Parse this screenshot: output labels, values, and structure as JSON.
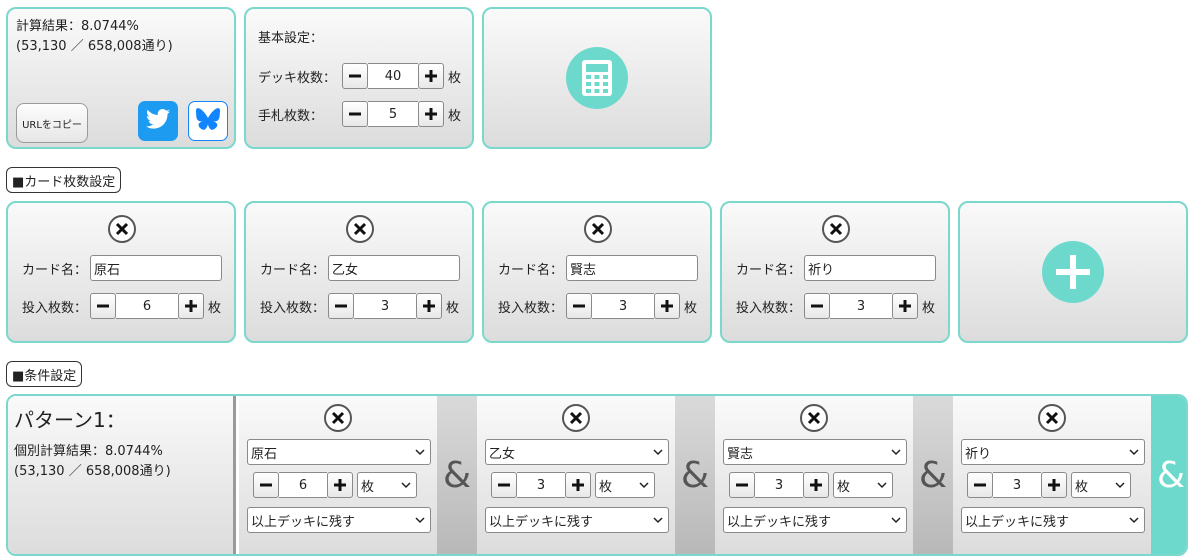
{
  "result": {
    "line1": "計算結果：8.0744%",
    "line2": "(53,130 ／ 658,008通り)",
    "copy_label": "URLをコピー",
    "twitter_icon": "twitter-bird-icon",
    "bluesky_icon": "bluesky-butterfly-icon"
  },
  "basic": {
    "title": "基本設定：",
    "deck_label": "デッキ枚数：",
    "deck_value": "40",
    "hand_label": "手札枚数：",
    "hand_value": "5",
    "unit": "枚",
    "calc_icon": "calculator-icon"
  },
  "cards_section": {
    "label": "■カード枚数設定"
  },
  "cards": [
    {
      "name_label": "カード名：",
      "name": "原石",
      "count_label": "投入枚数：",
      "count": "6",
      "unit": "枚"
    },
    {
      "name_label": "カード名：",
      "name": "乙女",
      "count_label": "投入枚数：",
      "count": "3",
      "unit": "枚"
    },
    {
      "name_label": "カード名：",
      "name": "賢志",
      "count_label": "投入枚数：",
      "count": "3",
      "unit": "枚"
    },
    {
      "name_label": "カード名：",
      "name": "祈り",
      "count_label": "投入枚数：",
      "count": "3",
      "unit": "枚"
    }
  ],
  "conditions_section": {
    "label": "■条件設定"
  },
  "pattern": {
    "title": "パターン1：",
    "result_line1": "個別計算結果：8.0744%",
    "result_line2": "(53,130 ／ 658,008通り)",
    "amp": "&",
    "conditions": [
      {
        "card": "原石",
        "count": "6",
        "unit": "枚",
        "mode": "以上デッキに残す"
      },
      {
        "card": "乙女",
        "count": "3",
        "unit": "枚",
        "mode": "以上デッキに残す"
      },
      {
        "card": "賢志",
        "count": "3",
        "unit": "枚",
        "mode": "以上デッキに残す"
      },
      {
        "card": "祈り",
        "count": "3",
        "unit": "枚",
        "mode": "以上デッキに残す"
      }
    ]
  },
  "colors": {
    "accent": "#6dd9cd",
    "border": "#7ad8cc",
    "twitter": "#1d9bf0",
    "bluesky": "#1185fe"
  }
}
